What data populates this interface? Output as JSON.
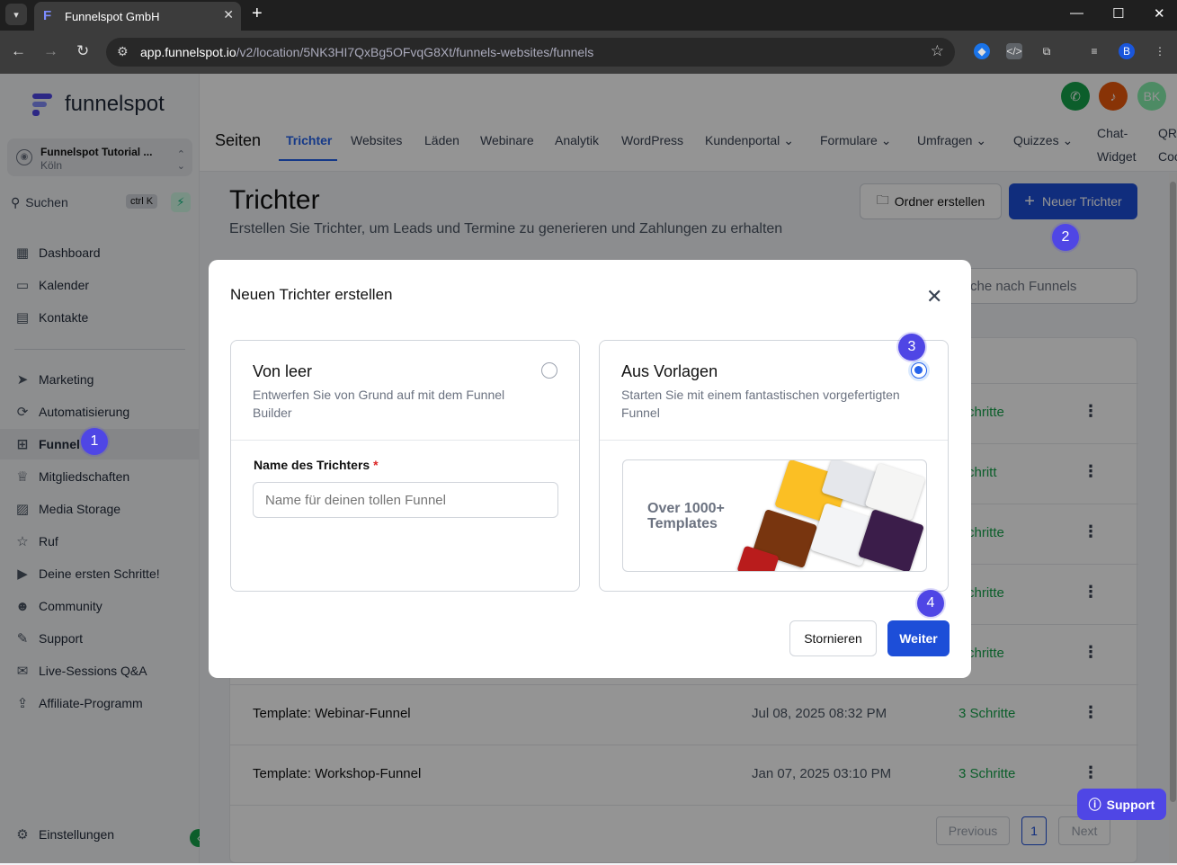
{
  "browser": {
    "tab_title": "Funnelspot GmbH",
    "url_domain": "app.funnelspot.io",
    "url_path": "/v2/location/5NK3HI7QxBg5OFvqG8Xt/funnels-websites/funnels",
    "profile_initial": "B"
  },
  "sidebar": {
    "brand": "funnelspot",
    "account_name": "Funnelspot Tutorial ...",
    "account_location": "Köln",
    "search_label": "Suchen",
    "search_shortcut": "ctrl K",
    "items": [
      {
        "label": "Dashboard",
        "icon": "dashboard-icon"
      },
      {
        "label": "Kalender",
        "icon": "calendar-icon"
      },
      {
        "label": "Kontakte",
        "icon": "contacts-icon"
      },
      {
        "label": "Marketing",
        "icon": "send-icon"
      },
      {
        "label": "Automatisierung",
        "icon": "automation-icon"
      },
      {
        "label": "Funnel",
        "icon": "funnel-icon"
      },
      {
        "label": "Mitgliedschaften",
        "icon": "membership-icon"
      },
      {
        "label": "Media Storage",
        "icon": "image-icon"
      },
      {
        "label": "Ruf",
        "icon": "star-icon"
      },
      {
        "label": "Deine ersten Schritte!",
        "icon": "play-icon"
      },
      {
        "label": "Community",
        "icon": "community-icon"
      },
      {
        "label": "Support",
        "icon": "wrench-icon"
      },
      {
        "label": "Live-Sessions Q&A",
        "icon": "chat-icon"
      },
      {
        "label": "Affiliate-Programm",
        "icon": "affiliate-icon"
      }
    ],
    "settings_label": "Einstellungen"
  },
  "topbar": {
    "section": "Seiten",
    "tabs": [
      "Trichter",
      "Websites",
      "Läden",
      "Webinare",
      "Analytik",
      "WordPress",
      "Kundenportal",
      "Formulare",
      "Umfragen",
      "Quizzes"
    ],
    "chat_widget_line1": "Chat-",
    "chat_widget_line2": "Widget",
    "qr_line1": "QR-",
    "qr_line2": "Coc",
    "user_initials": "BK"
  },
  "main": {
    "title": "Trichter",
    "subtitle": "Erstellen Sie Trichter, um Leads und Termine zu generieren und Zahlungen zu erhalten",
    "folder_button": "Ordner erstellen",
    "new_button": "Neuer Trichter",
    "search_placeholder": "che nach Funnels",
    "rows": [
      {
        "name": "",
        "date": "",
        "steps": "Schritte"
      },
      {
        "name": "",
        "date": "",
        "steps": "Schritt"
      },
      {
        "name": "",
        "date": "",
        "steps": "Schritte"
      },
      {
        "name": "",
        "date": "",
        "steps": "Schritte"
      },
      {
        "name": "",
        "date": "",
        "steps": "Schritte"
      },
      {
        "name": "Template: Webinar-Funnel",
        "date": "Jul 08, 2025 08:32 PM",
        "steps": "3 Schritte"
      },
      {
        "name": "Template: Workshop-Funnel",
        "date": "Jan 07, 2025 03:10 PM",
        "steps": "3 Schritte"
      }
    ],
    "pagination": {
      "previous": "Previous",
      "page": "1",
      "next": "Next"
    }
  },
  "support_label": "Support",
  "modal": {
    "title": "Neuen Trichter erstellen",
    "option_blank": {
      "title": "Von leer",
      "description": "Entwerfen Sie von Grund auf mit dem Funnel Builder",
      "selected": false
    },
    "option_template": {
      "title": "Aus Vorlagen",
      "description": "Starten Sie mit einem fantastischen vorgefertigten Funnel",
      "selected": true
    },
    "name_label": "Name des Trichters",
    "name_required": "*",
    "name_placeholder": "Name für deinen tollen Funnel",
    "preview_text_line1": "Over 1000+",
    "preview_text_line2": "Templates",
    "cancel": "Stornieren",
    "next": "Weiter"
  },
  "step_badges": [
    "1",
    "2",
    "3",
    "4"
  ],
  "colors": {
    "accent": "#2563eb",
    "primary_button": "#1d4ed8",
    "badge": "#4f46e5",
    "success": "#16a34a"
  }
}
